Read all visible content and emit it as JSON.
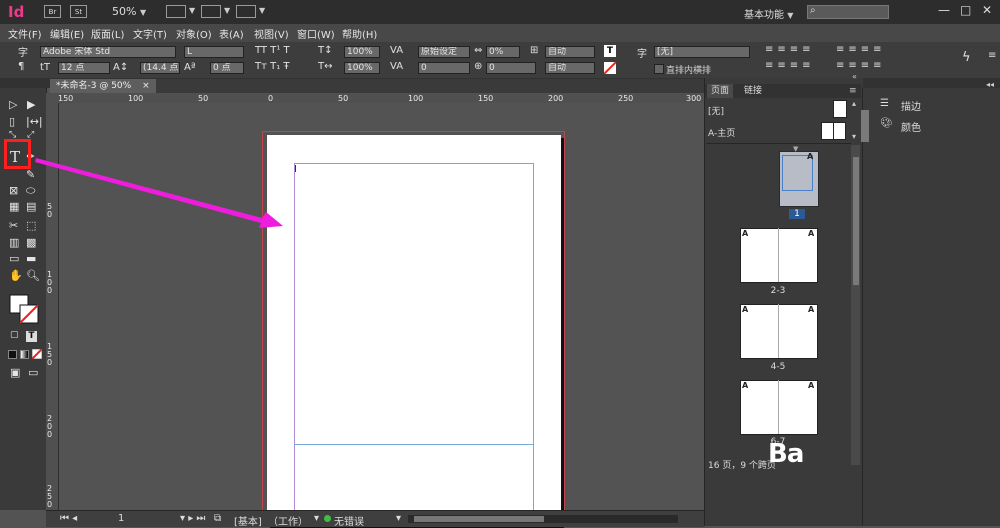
{
  "appbar": {
    "logo": "Id",
    "bridge": "Br",
    "stock": "St",
    "zoom": "50%",
    "workspace": "基本功能",
    "minimize": "—",
    "restore": "□",
    "close": "✕"
  },
  "menubar": [
    "文件(F)",
    "编辑(E)",
    "版面(L)",
    "文字(T)",
    "对象(O)",
    "表(A)",
    "视图(V)",
    "窗口(W)",
    "帮助(H)"
  ],
  "control": {
    "font_family": "Adobe 宋体 Std",
    "font_style": "L",
    "font_size": "12 点",
    "leading": "(14.4 点",
    "tracking_pct_h": "100%",
    "tracking_pct_v": "100%",
    "kerning": "原始设定",
    "tracking": "0",
    "tsume": "0%",
    "baseline": "0 点",
    "char_rotation": "0",
    "aki": "0",
    "auto1": "自动",
    "auto2": "自动",
    "char_style": "[无]",
    "tate_chu_yoko": "直排内横排"
  },
  "document": {
    "tab_title": "*未命名-3 @ 50%",
    "tab_close": "×"
  },
  "ruler_h": [
    "150",
    "100",
    "50",
    "0",
    "50",
    "100",
    "150",
    "200",
    "250",
    "300"
  ],
  "ruler_v": [
    "5 0",
    "1 0 0",
    "1 5 0",
    "2 0 0",
    "2 5 0"
  ],
  "status": {
    "page": "1",
    "master": "[基本]",
    "mode": "（工作）",
    "preflight": "无错误"
  },
  "pages_panel": {
    "tab_pages": "页面",
    "tab_links": "链接",
    "master_none": "[无]",
    "master_a": "A-主页",
    "pages": [
      {
        "label": "1",
        "letter": "A"
      },
      {
        "label": "2-3",
        "letter": "A"
      },
      {
        "label": "4-5",
        "letter": "A"
      },
      {
        "label": "6-7",
        "letter": "A"
      }
    ],
    "footer": "16 页，9 个跨页"
  },
  "right_panel": {
    "stroke": "描边",
    "color": "颜色"
  },
  "watermark": "Ba",
  "colors": {
    "accent_magenta": "#ee3a8c",
    "highlight_red": "#ff1f1f",
    "arrow_magenta": "#ee1cdc",
    "ok_green": "#3fbf3f"
  },
  "icons": [
    "arrow-icon",
    "direct-select-icon",
    "type-icon",
    "pen-icon",
    "pencil-icon",
    "line-icon",
    "rect-frame-icon",
    "ellipse-icon",
    "table-icon",
    "scissors-icon",
    "free-transform-icon",
    "gradient-icon",
    "hand-icon",
    "zoom-icon",
    "fill-stroke-icon"
  ]
}
